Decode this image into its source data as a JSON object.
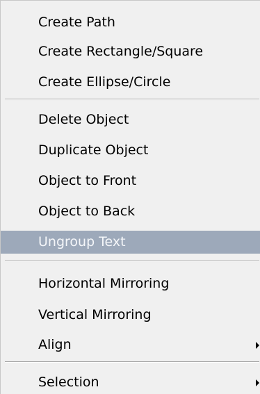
{
  "menu": {
    "items": [
      {
        "label": "Create Path"
      },
      {
        "label": "Create Rectangle/Square"
      },
      {
        "label": "Create Ellipse/Circle"
      },
      {
        "label": "Delete Object"
      },
      {
        "label": "Duplicate Object"
      },
      {
        "label": "Object to Front"
      },
      {
        "label": "Object to Back"
      },
      {
        "label": "Ungroup Text",
        "state": "disabled"
      },
      {
        "label": "Horizontal Mirroring"
      },
      {
        "label": "Vertical Mirroring"
      },
      {
        "label": "Align",
        "submenu_icon": "chevron-right-icon"
      },
      {
        "label": "Selection",
        "submenu_icon": "chevron-right-icon"
      }
    ]
  },
  "colors": {
    "menu_background": "#f0f0f0",
    "disabled_background": "#9da9ba",
    "disabled_text": "#f4f6f9",
    "separator": "#a0a0a0"
  }
}
